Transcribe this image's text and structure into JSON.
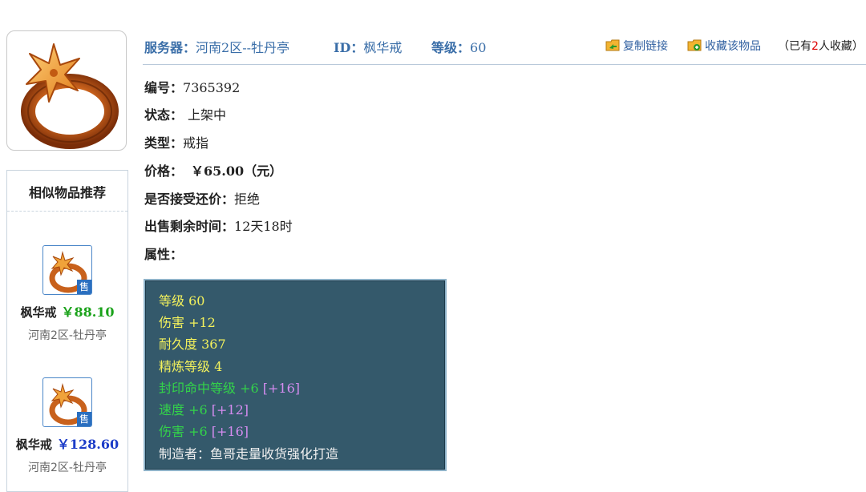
{
  "header": {
    "server_label": "服务器：",
    "server_value": "河南2区--牡丹亭",
    "id_label": "ID：",
    "id_value": "枫华戒",
    "level_label": "等级：",
    "level_value": "60",
    "copy_link": "复制链接",
    "favorite": "收藏该物品",
    "fav_prefix": "（已有",
    "fav_count": "2",
    "fav_suffix": "人收藏）"
  },
  "info": {
    "serial_label": "编号：",
    "serial_value": "7365392",
    "status_label": "状态：",
    "status_value": "上架中",
    "type_label": "类型：",
    "type_value": "戒指",
    "price_label": "价格：",
    "price_value": "￥65.00（元）",
    "bargain_label": "是否接受还价：",
    "bargain_value": "拒绝",
    "time_label": "出售剩余时间：",
    "time_value": "12天18时",
    "attr_label": "属性："
  },
  "attributes": {
    "line1": "等级 60",
    "line2": "伤害 +12",
    "line3": "耐久度 367",
    "line4": "精炼等级 4",
    "line5_main": "封印命中等级 +6 ",
    "line5_extra": "[+16]",
    "line6_main": "速度 +6 ",
    "line6_extra": "[+12]",
    "line7_main": "伤害 +6 ",
    "line7_extra": "[+16]",
    "line8": "制造者：鱼哥走量收货强化打造"
  },
  "similar": {
    "title": "相似物品推荐",
    "sale_tag": "售",
    "items": [
      {
        "name": "枫华戒",
        "price": "￥88.10",
        "price_color": "#1aa21a",
        "server": "河南2区-牡丹亭"
      },
      {
        "name": "枫华戒",
        "price": "￥128.60",
        "price_color": "#1c3cc8",
        "server": "河南2区-牡丹亭"
      }
    ]
  },
  "icons": {
    "main_image": "maple-ring-icon",
    "copy": "folder-copy-icon",
    "favorite": "folder-add-icon"
  }
}
